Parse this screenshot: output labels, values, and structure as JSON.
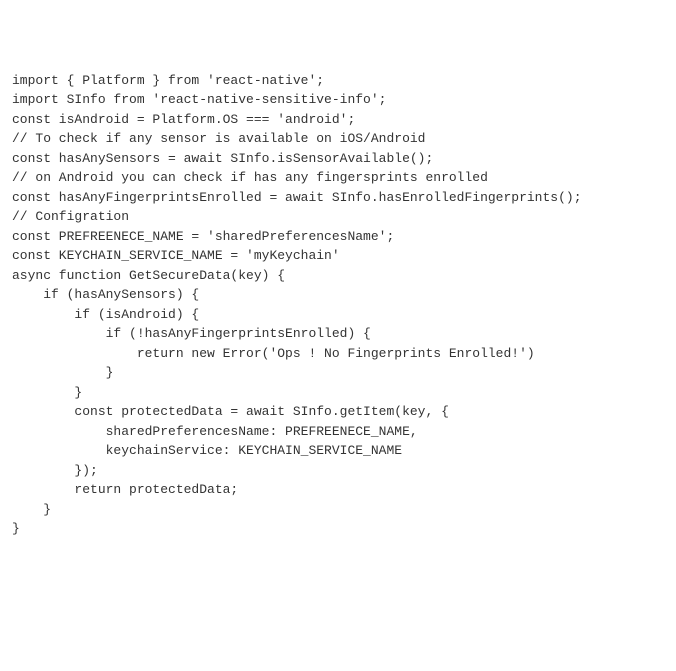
{
  "code": {
    "lines": [
      "import { Platform } from 'react-native';",
      "import SInfo from 'react-native-sensitive-info';",
      "",
      "const isAndroid = Platform.OS === 'android';",
      "",
      "// To check if any sensor is available on iOS/Android",
      "const hasAnySensors = await SInfo.isSensorAvailable();",
      "",
      "// on Android you can check if has any fingersprints enrolled",
      "const hasAnyFingerprintsEnrolled = await SInfo.hasEnrolledFingerprints();",
      "",
      "// Configration",
      "const PREFREENECE_NAME = 'sharedPreferencesName';",
      "const KEYCHAIN_SERVICE_NAME = 'myKeychain'",
      "",
      "async function GetSecureData(key) {",
      "",
      "    if (hasAnySensors) {",
      "",
      "        if (isAndroid) {",
      "            if (!hasAnyFingerprintsEnrolled) {",
      "                return new Error('Ops ! No Fingerprints Enrolled!')",
      "            }",
      "        }",
      "",
      "        const protectedData = await SInfo.getItem(key, {",
      "            sharedPreferencesName: PREFREENECE_NAME,",
      "            keychainService: KEYCHAIN_SERVICE_NAME",
      "        });",
      "",
      "        return protectedData;",
      "",
      "    }",
      "}"
    ]
  }
}
